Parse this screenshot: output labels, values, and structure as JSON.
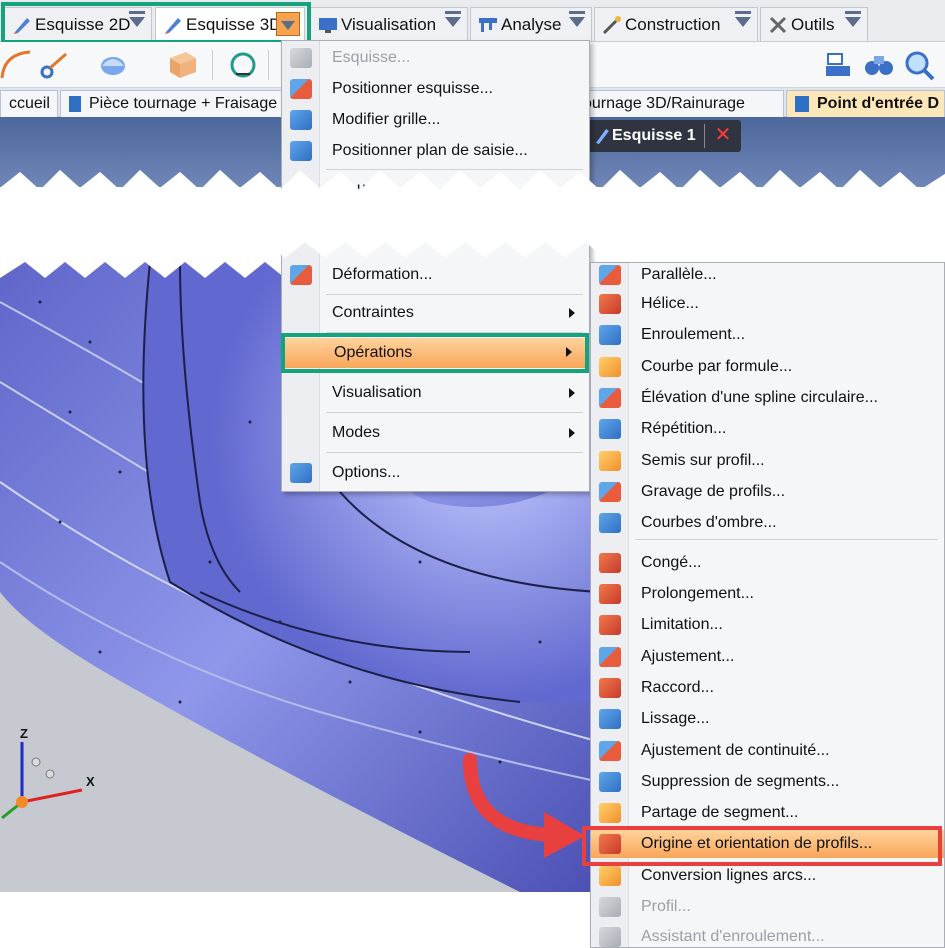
{
  "ribbon": {
    "tabs": [
      {
        "label": "Esquisse 2D",
        "icon": "pencil-icon"
      },
      {
        "label": "Esquisse 3D",
        "icon": "pencil-icon",
        "active": true
      },
      {
        "label": "Visualisation",
        "icon": "monitor-icon"
      },
      {
        "label": "Analyse",
        "icon": "caliper-icon"
      },
      {
        "label": "Construction",
        "icon": "wand-icon"
      },
      {
        "label": "Outils",
        "icon": "tools-icon"
      }
    ]
  },
  "doc_tabs": [
    {
      "label": "ccueil"
    },
    {
      "label": "Pièce tournage + Fraisage"
    },
    {
      "label": "ournage 3D/Rainurage"
    },
    {
      "label": "Point d'entrée D",
      "active": true
    }
  ],
  "sketch_tab": {
    "label": "Esquisse 1",
    "close": "✕"
  },
  "menu_left": {
    "items_top": [
      {
        "label": "Esquisse...",
        "disabled": true
      },
      {
        "label": "Positionner esquisse..."
      },
      {
        "label": "Modifier grille..."
      },
      {
        "label": "Positionner plan de saisie..."
      }
    ],
    "cut_item": "Co   ur",
    "items_bottom": [
      {
        "label": "Déformation..."
      },
      {
        "label": "Contraintes",
        "submenu": true
      },
      {
        "label": "Opérations",
        "submenu": true,
        "highlight": true
      },
      {
        "label": "Visualisation",
        "submenu": true
      },
      {
        "label": "Modes",
        "submenu": true
      },
      {
        "label": "Options..."
      }
    ]
  },
  "menu_right": {
    "items": [
      {
        "label": "Parallèle..."
      },
      {
        "label": "Hélice..."
      },
      {
        "label": "Enroulement..."
      },
      {
        "label": "Courbe par formule..."
      },
      {
        "label": "Élévation d'une spline circulaire..."
      },
      {
        "label": "Répétition..."
      },
      {
        "label": "Semis sur profil..."
      },
      {
        "label": "Gravage de profils..."
      },
      {
        "label": "Courbes d'ombre..."
      },
      {
        "label": "Congé..."
      },
      {
        "label": "Prolongement..."
      },
      {
        "label": "Limitation..."
      },
      {
        "label": "Ajustement..."
      },
      {
        "label": "Raccord..."
      },
      {
        "label": "Lissage..."
      },
      {
        "label": "Ajustement de continuité..."
      },
      {
        "label": "Suppression de segments..."
      },
      {
        "label": "Partage de segment..."
      },
      {
        "label": "Origine et orientation de profils...",
        "highlight": true
      },
      {
        "label": "Conversion lignes arcs..."
      },
      {
        "label": "Profil...",
        "disabled": true
      },
      {
        "label": "Assistant d'enroulement...",
        "disabled": true
      }
    ]
  },
  "axes": {
    "z": "Z",
    "x": "X"
  },
  "colors": {
    "highlight_box": "#14a37c",
    "callout_red": "#e8403f",
    "menu_highlight": "#f8a65a",
    "part_surface": "#7d86e0"
  }
}
